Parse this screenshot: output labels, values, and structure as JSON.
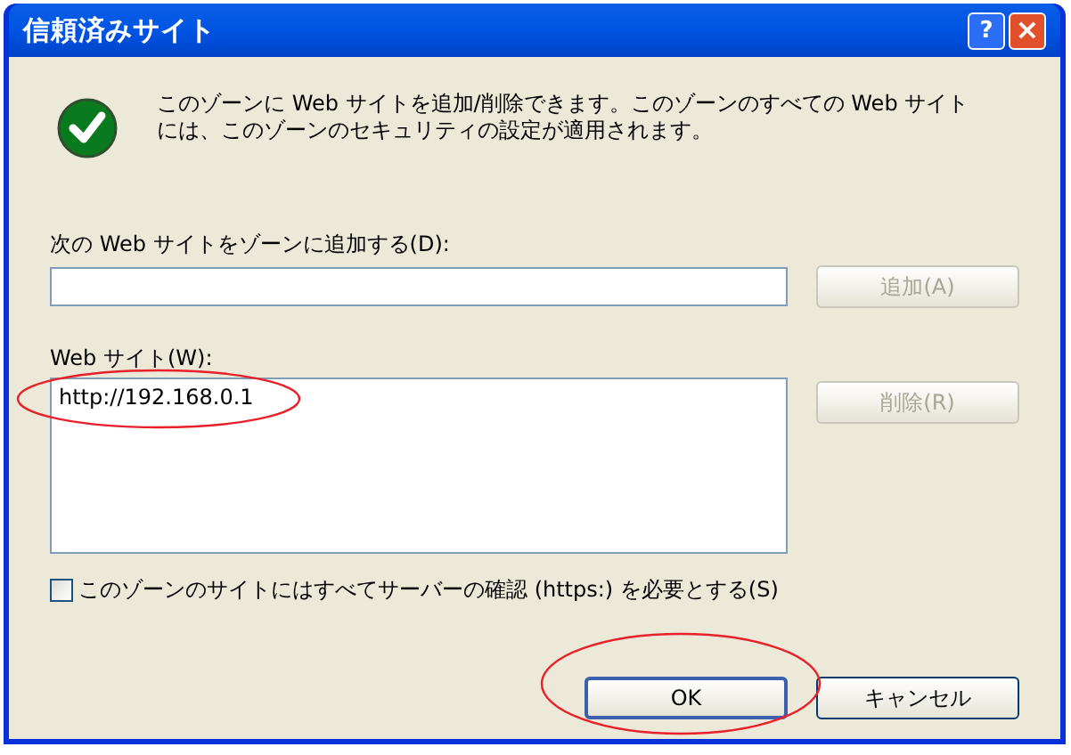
{
  "window": {
    "title": "信頼済みサイト",
    "help_button": "?",
    "close_button": "×"
  },
  "message": "このゾーンに Web サイトを追加/削除できます。このゾーンのすべての Web サイトには、このゾーンのセキュリティの設定が適用されます。",
  "add_field": {
    "label": "次の Web サイトをゾーンに追加する(D):"
  },
  "add_button": {
    "label": "追加(A)",
    "disabled": true
  },
  "sites": {
    "label": "Web サイト(W):",
    "items": [
      {
        "text": "http://192.168.0.1",
        "selected": false
      }
    ]
  },
  "remove_button": {
    "label": "削除(R)",
    "disabled": true
  },
  "require_https": {
    "label": "このゾーンのサイトにはすべてサーバーの確認 (https:) を必要とする(S)",
    "checked": false
  },
  "buttons": [
    {
      "label": "OK",
      "default": true
    },
    {
      "label": "キャンセル",
      "default": false
    }
  ]
}
